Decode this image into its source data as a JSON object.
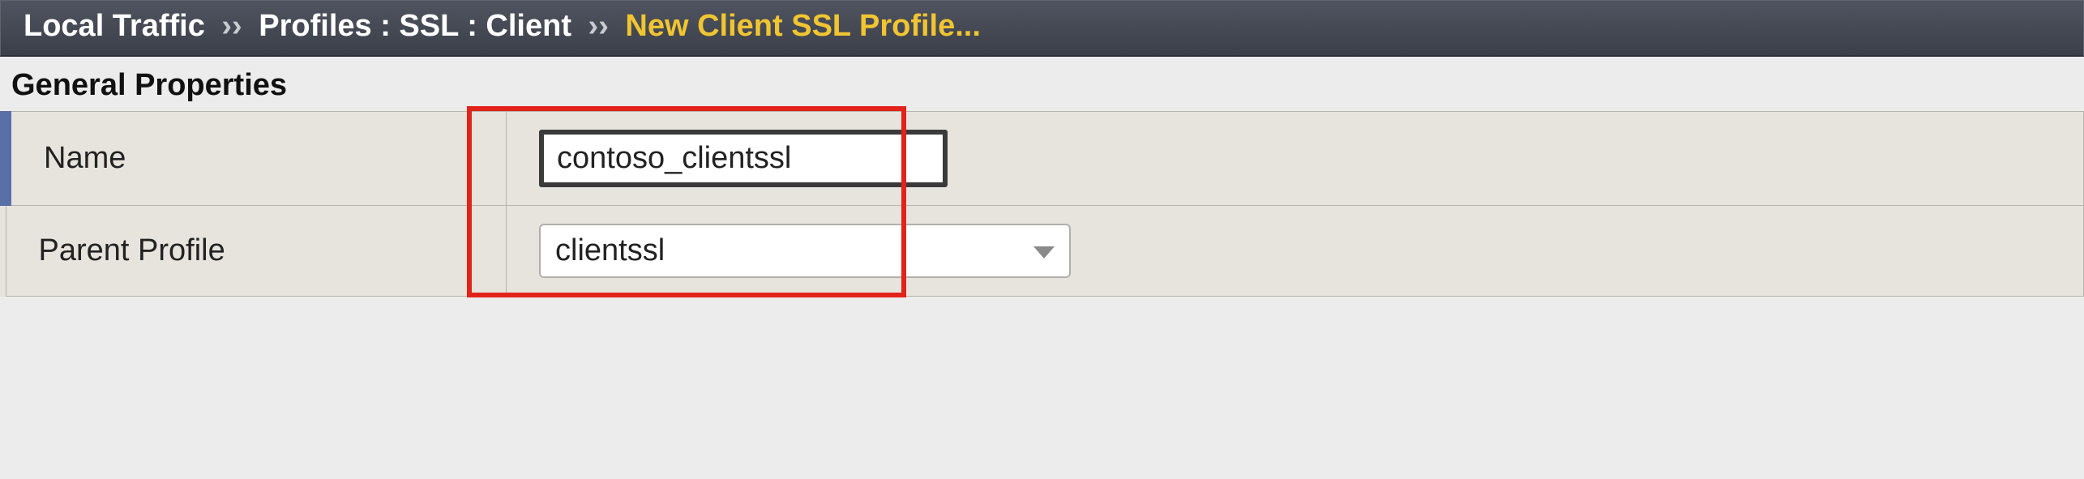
{
  "breadcrumb": {
    "root": "Local Traffic",
    "mid": "Profiles : SSL : Client",
    "current": "New Client SSL Profile...",
    "sep": "››"
  },
  "section": {
    "title": "General Properties"
  },
  "fields": {
    "name": {
      "label": "Name",
      "value": "contoso_clientssl"
    },
    "parentProfile": {
      "label": "Parent Profile",
      "value": "clientssl"
    }
  }
}
